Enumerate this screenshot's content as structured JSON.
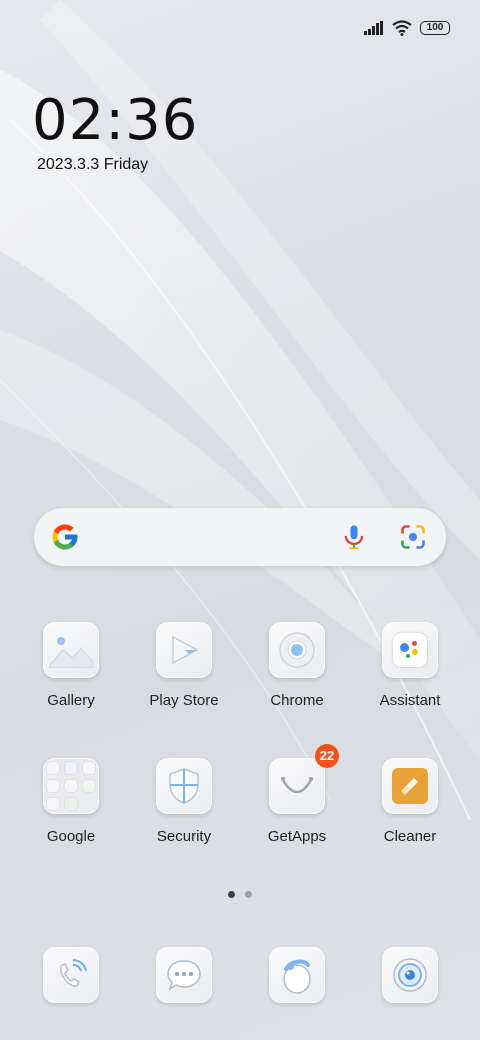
{
  "status_bar": {
    "battery": "100"
  },
  "lock": {
    "time": "02:36",
    "date": "2023.3.3 Friday"
  },
  "search": {
    "mic": "mic-icon",
    "lens": "lens-icon"
  },
  "apps": [
    {
      "label": "Gallery",
      "icon": "gallery-icon"
    },
    {
      "label": "Play Store",
      "icon": "play-store-icon"
    },
    {
      "label": "Chrome",
      "icon": "chrome-icon"
    },
    {
      "label": "Assistant",
      "icon": "assistant-icon"
    },
    {
      "label": "Google",
      "icon": "folder-icon"
    },
    {
      "label": "Security",
      "icon": "shield-icon"
    },
    {
      "label": "GetApps",
      "icon": "getapps-icon",
      "badge": "22"
    },
    {
      "label": "Cleaner",
      "icon": "broom-icon"
    }
  ],
  "dock": [
    {
      "icon": "phone-icon"
    },
    {
      "icon": "messages-icon"
    },
    {
      "icon": "browser-icon"
    },
    {
      "icon": "camera-icon"
    }
  ],
  "pages": {
    "count": 2,
    "active": 0
  },
  "colors": {
    "badge": "#f4511e",
    "accent_blue": "#4285f4",
    "cleaner": "#e8a23a"
  }
}
